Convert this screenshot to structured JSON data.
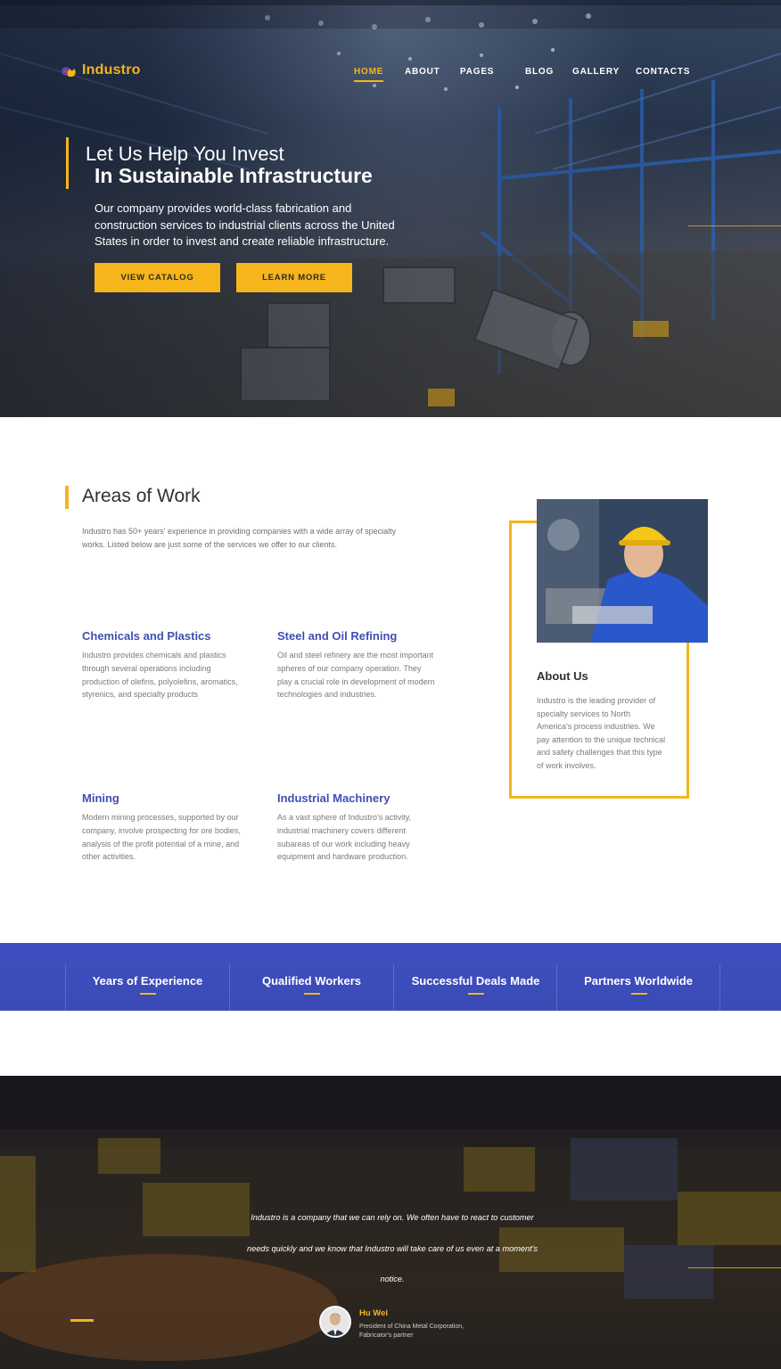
{
  "brand": {
    "name": "Industro",
    "logo_icon": "gear-flame-icon",
    "accent_color": "#f5b51b",
    "primary_color": "#3f4fbf"
  },
  "nav": {
    "items": [
      {
        "label": "HOME",
        "active": true
      },
      {
        "label": "ABOUT",
        "active": false
      },
      {
        "label": "PAGES",
        "active": false
      },
      {
        "label": "BLOG",
        "active": false
      },
      {
        "label": "GALLERY",
        "active": false
      },
      {
        "label": "CONTACTS",
        "active": false
      }
    ]
  },
  "hero": {
    "title_light": "Let Us Help You Invest",
    "title_bold": "In Sustainable Infrastructure",
    "description": "Our company provides world-class fabrication and construction services to industrial clients across the United States in order to invest and create reliable infrastructure.",
    "primary_button": "VIEW CATALOG",
    "secondary_button": "LEARN MORE"
  },
  "areas": {
    "title": "Areas of Work",
    "intro": "Industro has 50+ years' experience in providing companies with a wide array of specialty works. Listed below are just some of the services we offer to our clients.",
    "services": [
      {
        "title": "Chemicals and Plastics",
        "text": "Industro provides chemicals and plastics through several operations including production of olefins, polyolefins, aromatics, styrenics, and specialty products"
      },
      {
        "title": "Steel and Oil Refining",
        "text": "Oil and steel refinery are the most important spheres of our company operation. They play a crucial role in development of modern technologies and industries."
      },
      {
        "title": "Mining",
        "text": "Modern mining processes, supported by our company, involve prospecting for ore bodies, analysis of the profit potential of a mine, and other activities."
      },
      {
        "title": "Industrial Machinery",
        "text": "As a vast sphere of Industro's activity, industrial machinery covers different subareas of our work including heavy equipment and hardware production."
      }
    ]
  },
  "about": {
    "title": "About Us",
    "text": "Industro is the leading provider of specialty services to North America's process industries. We pay attention to the unique technical and safety challenges that this type of work involves."
  },
  "stats": {
    "items": [
      {
        "label": "Years of Experience"
      },
      {
        "label": "Qualified Workers"
      },
      {
        "label": "Successful Deals Made"
      },
      {
        "label": "Partners Worldwide"
      }
    ]
  },
  "testimonial": {
    "quote": "Industro is a company that we can rely on. We often have to react to customer needs quickly and we know that Industro will take care of us even at a moment's notice.",
    "author": "Hu Wei",
    "role": "President of China Metal Corporation, Fabricator's partner"
  }
}
